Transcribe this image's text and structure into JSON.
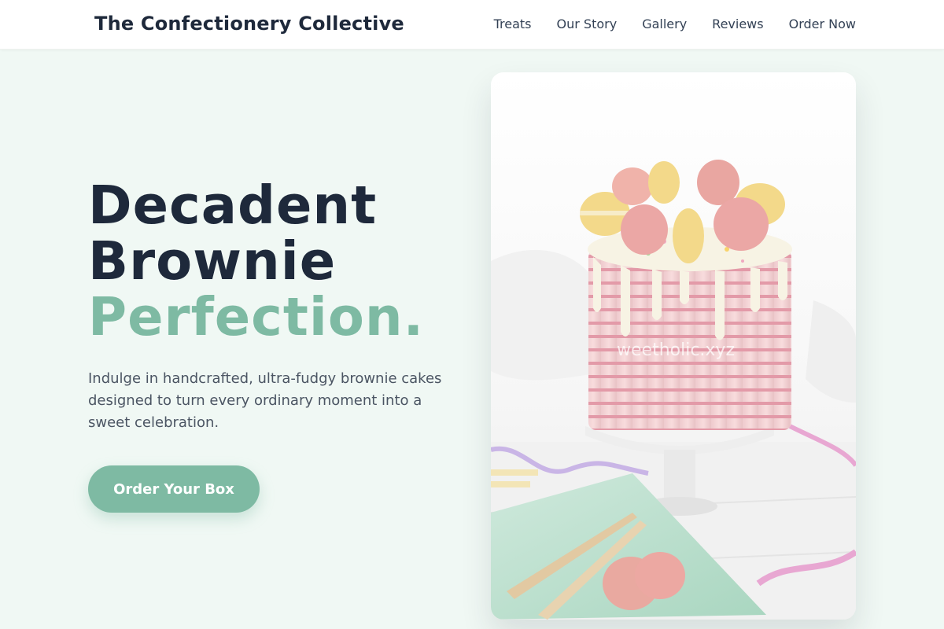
{
  "header": {
    "brand": "The Confectionery Collective",
    "nav": [
      "Treats",
      "Our Story",
      "Gallery",
      "Reviews",
      "Order Now"
    ]
  },
  "hero": {
    "title_line1": "Decadent",
    "title_line2": "Brownie",
    "title_line3": "Perfection.",
    "description": "Indulge in handcrafted, ultra-fudgy brownie cakes designed to turn every ordinary moment into a sweet celebration.",
    "cta_label": "Order Your Box",
    "image_watermark": "weetholic.xyz"
  },
  "colors": {
    "accent": "#7ebaa3",
    "dark": "#1e293b",
    "background": "#f0f8f4"
  }
}
